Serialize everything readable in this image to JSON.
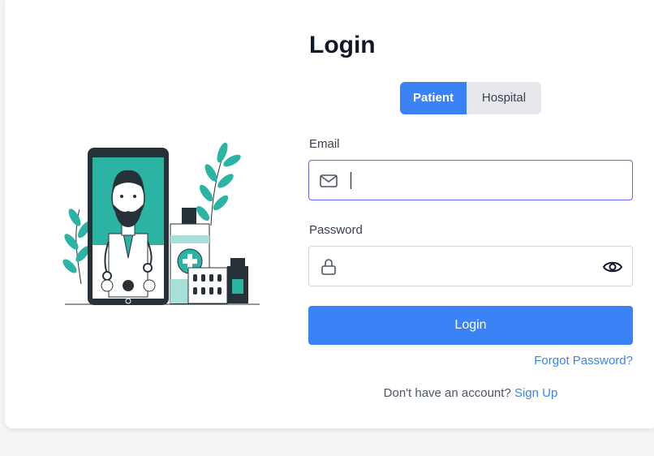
{
  "title": "Login",
  "tabs": [
    {
      "label": "Patient",
      "active": true
    },
    {
      "label": "Hospital",
      "active": false
    }
  ],
  "email": {
    "label": "Email",
    "value": "",
    "placeholder": "",
    "icon": "mail-icon"
  },
  "password": {
    "label": "Password",
    "value": "",
    "placeholder": "",
    "icon": "lock-icon",
    "toggle_icon": "eye-icon"
  },
  "login_button": "Login",
  "forgot_password": "Forgot Password?",
  "signup": {
    "prompt": "Don't have an account?",
    "link": "Sign Up"
  },
  "colors": {
    "primary": "#3b82f6",
    "teal": "#2bb3a3",
    "dark": "#263238"
  }
}
